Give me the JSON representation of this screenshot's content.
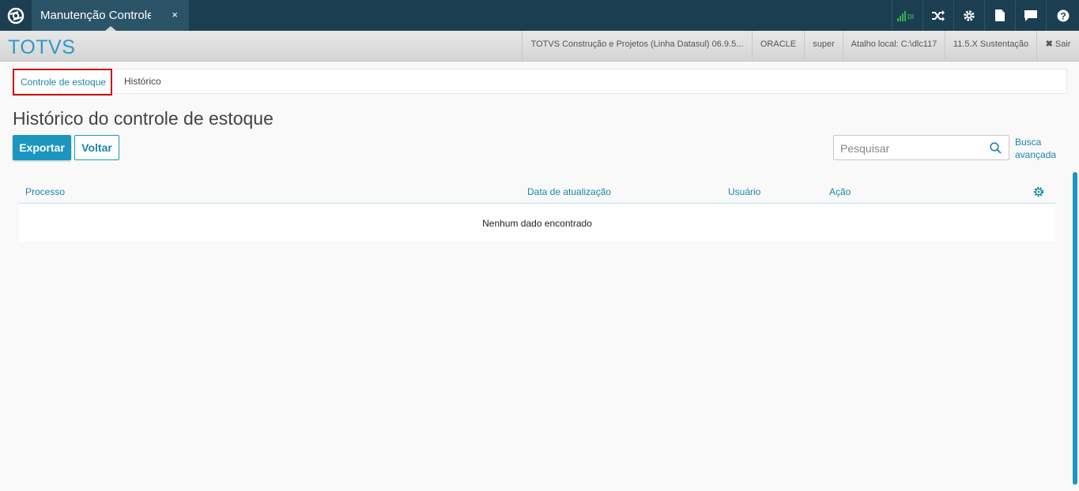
{
  "topbar": {
    "tab_label": "Manutenção Controle de Estoque",
    "tab_close": "×",
    "icons": [
      "totvs-logo-icon",
      "signal-icon",
      "shuffle-icon",
      "gear-icon",
      "document-icon",
      "chat-icon",
      "help-icon"
    ],
    "signal_text": "DI",
    "colors": {
      "bar": "#1b3f51",
      "tab": "#2b5468",
      "signal": "#37b24d"
    }
  },
  "header": {
    "brand": "TOTVS",
    "product": "TOTVS Construção e Projetos (Linha Datasul) 06.9.5...",
    "database": "ORACLE",
    "user": "super",
    "local_shortcut": "Atalho local: C:\\dlc117",
    "version": "11.5.X Sustentação",
    "logout": "Sair"
  },
  "breadcrumb": {
    "items": [
      {
        "label": "Controle de estoque"
      },
      {
        "label": "Histórico"
      }
    ]
  },
  "page": {
    "title": "Histórico do controle de estoque",
    "export_button": "Exportar",
    "back_button": "Voltar",
    "search_placeholder": "Pesquisar",
    "advanced_search_line1": "Busca",
    "advanced_search_line2": "avançada"
  },
  "table": {
    "columns": [
      "Processo",
      "Data de atualização",
      "Usuário",
      "Ação"
    ],
    "empty_message": "Nenhum dado encontrado"
  },
  "colors": {
    "accent": "#1b97bf",
    "highlight_border": "#cc0f0f"
  }
}
